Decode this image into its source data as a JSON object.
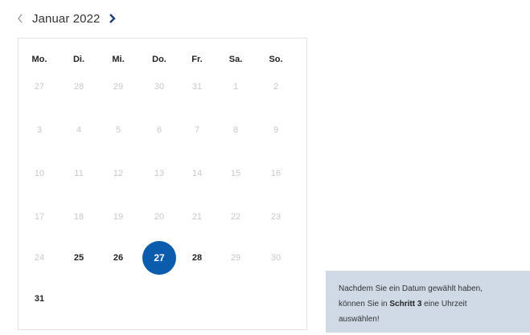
{
  "header": {
    "month_label": "Januar 2022",
    "prev_icon": "chevron-left-icon",
    "next_icon": "chevron-right-icon"
  },
  "calendar": {
    "weekdays": [
      "Mo.",
      "Di.",
      "Mi.",
      "Do.",
      "Fr.",
      "Sa.",
      "So."
    ],
    "weeks": [
      [
        {
          "label": "27",
          "state": "disabled"
        },
        {
          "label": "28",
          "state": "disabled"
        },
        {
          "label": "29",
          "state": "disabled"
        },
        {
          "label": "30",
          "state": "disabled"
        },
        {
          "label": "31",
          "state": "disabled"
        },
        {
          "label": "1",
          "state": "disabled"
        },
        {
          "label": "2",
          "state": "disabled"
        }
      ],
      [
        {
          "label": "3",
          "state": "disabled"
        },
        {
          "label": "4",
          "state": "disabled"
        },
        {
          "label": "5",
          "state": "disabled"
        },
        {
          "label": "6",
          "state": "disabled"
        },
        {
          "label": "7",
          "state": "disabled"
        },
        {
          "label": "8",
          "state": "disabled"
        },
        {
          "label": "9",
          "state": "disabled"
        }
      ],
      [
        {
          "label": "10",
          "state": "disabled"
        },
        {
          "label": "11",
          "state": "disabled"
        },
        {
          "label": "12",
          "state": "disabled"
        },
        {
          "label": "13",
          "state": "disabled"
        },
        {
          "label": "14",
          "state": "disabled"
        },
        {
          "label": "15",
          "state": "disabled"
        },
        {
          "label": "16",
          "state": "disabled"
        }
      ],
      [
        {
          "label": "17",
          "state": "disabled"
        },
        {
          "label": "18",
          "state": "disabled"
        },
        {
          "label": "19",
          "state": "disabled"
        },
        {
          "label": "20",
          "state": "disabled"
        },
        {
          "label": "21",
          "state": "disabled"
        },
        {
          "label": "22",
          "state": "disabled"
        },
        {
          "label": "23",
          "state": "disabled"
        }
      ],
      [
        {
          "label": "24",
          "state": "disabled"
        },
        {
          "label": "25",
          "state": "available"
        },
        {
          "label": "26",
          "state": "available"
        },
        {
          "label": "27",
          "state": "selected"
        },
        {
          "label": "28",
          "state": "available"
        },
        {
          "label": "29",
          "state": "disabled"
        },
        {
          "label": "30",
          "state": "disabled"
        }
      ],
      [
        {
          "label": "31",
          "state": "available"
        }
      ]
    ]
  },
  "hint": {
    "line1": "Nachdem Sie ein Datum gewählt haben,",
    "line2_before": "können Sie in ",
    "line2_bold": "Schritt 3",
    "line2_after": " eine Uhrzeit",
    "line3": "auswählen!"
  },
  "colors": {
    "accent": "#0b5cad",
    "nav_next": "#1f3f73",
    "nav_prev": "#9a9a9a",
    "hint_background": "#cfdae6"
  }
}
